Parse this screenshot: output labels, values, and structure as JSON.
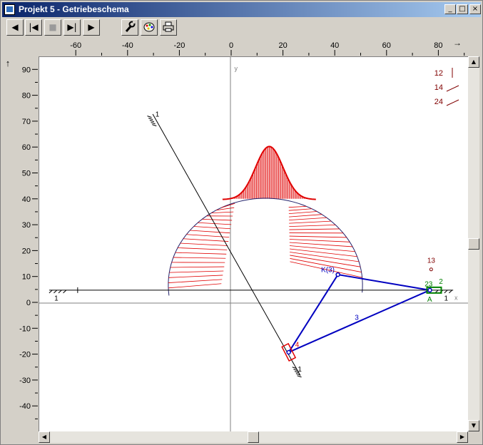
{
  "window": {
    "title": "Projekt 5 - Getriebeschema",
    "controls": {
      "minimize": "_",
      "maximize": "□",
      "close": "×"
    }
  },
  "toolbar": {
    "buttons": [
      {
        "name": "play-reverse-button",
        "glyph": "◀",
        "enabled": true
      },
      {
        "name": "go-to-start-button",
        "glyph": "|◀",
        "enabled": true
      },
      {
        "name": "stop-button",
        "glyph": "■",
        "enabled": false
      },
      {
        "name": "go-to-end-button",
        "glyph": "▶|",
        "enabled": true
      },
      {
        "name": "play-forward-button",
        "glyph": "▶",
        "enabled": true
      },
      {
        "name": "tool-settings-button",
        "icon": "wrench-icon",
        "enabled": true
      },
      {
        "name": "color-palette-button",
        "icon": "palette-icon",
        "enabled": true
      },
      {
        "name": "print-button",
        "icon": "printer-icon",
        "enabled": true
      }
    ]
  },
  "rulers": {
    "x_ticks": [
      "-60",
      "-40",
      "-20",
      "0",
      "20",
      "40",
      "60",
      "80"
    ],
    "y_ticks": [
      "90",
      "80",
      "70",
      "60",
      "50",
      "40",
      "30",
      "20",
      "10",
      "0",
      "-10",
      "-20",
      "-30",
      "-40"
    ],
    "x_arrow": "→",
    "y_arrow": "↑"
  },
  "diagram": {
    "axis_x_label": "x",
    "axis_y_label": "y",
    "legend": [
      {
        "label": "12",
        "slope": "vertical"
      },
      {
        "label": "14",
        "slope": "shallow"
      },
      {
        "label": "24",
        "slope": "shallow"
      }
    ],
    "labels": {
      "ground_left": "1",
      "ground_right": "1",
      "guide_top": "1",
      "guide_bottom": "1",
      "link3": "3",
      "coupler_point": "K(3)",
      "joint13": "13",
      "joint2": "2",
      "joint23": "23",
      "pointA": "A",
      "joint4": "4"
    },
    "colors": {
      "mechanism": "#0000c0",
      "trace": "#e00000",
      "envelope": "#20206a",
      "annotation": "#800000",
      "slider_A": "#008000",
      "ground": "#000000",
      "axes": "#808080"
    },
    "mechanism": {
      "pivot_A": [
        77,
        5
      ],
      "coupler_K": [
        41.5,
        11
      ],
      "slider_4": [
        22.5,
        -19
      ],
      "guide_line": {
        "from": [
          -30,
          73
        ],
        "to": [
          27,
          -28
        ]
      },
      "ground_line_y": 5
    }
  }
}
